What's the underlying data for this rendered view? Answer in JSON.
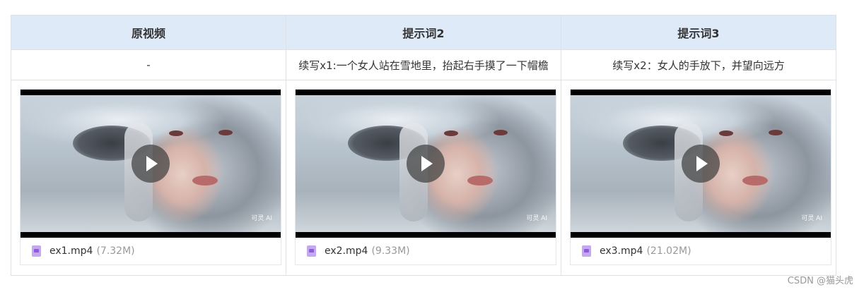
{
  "table": {
    "headers": [
      "原视频",
      "提示词2",
      "提示词3"
    ],
    "prompts": [
      "-",
      "续写x1:一个女人站在雪地里，抬起右手摸了一下帽檐",
      "续写x2：女人的手放下，并望向远方"
    ],
    "videos": [
      {
        "name": "ex1.mp4",
        "size": "(7.32M)",
        "watermark": "可灵 AI"
      },
      {
        "name": "ex2.mp4",
        "size": "(9.33M)",
        "watermark": "可灵 AI"
      },
      {
        "name": "ex3.mp4",
        "size": "(21.02M)",
        "watermark": "可灵 AI"
      }
    ]
  },
  "footer": {
    "credit": "CSDN @猫头虎"
  },
  "icons": {
    "play": "play-icon",
    "file": "video-file-icon"
  }
}
